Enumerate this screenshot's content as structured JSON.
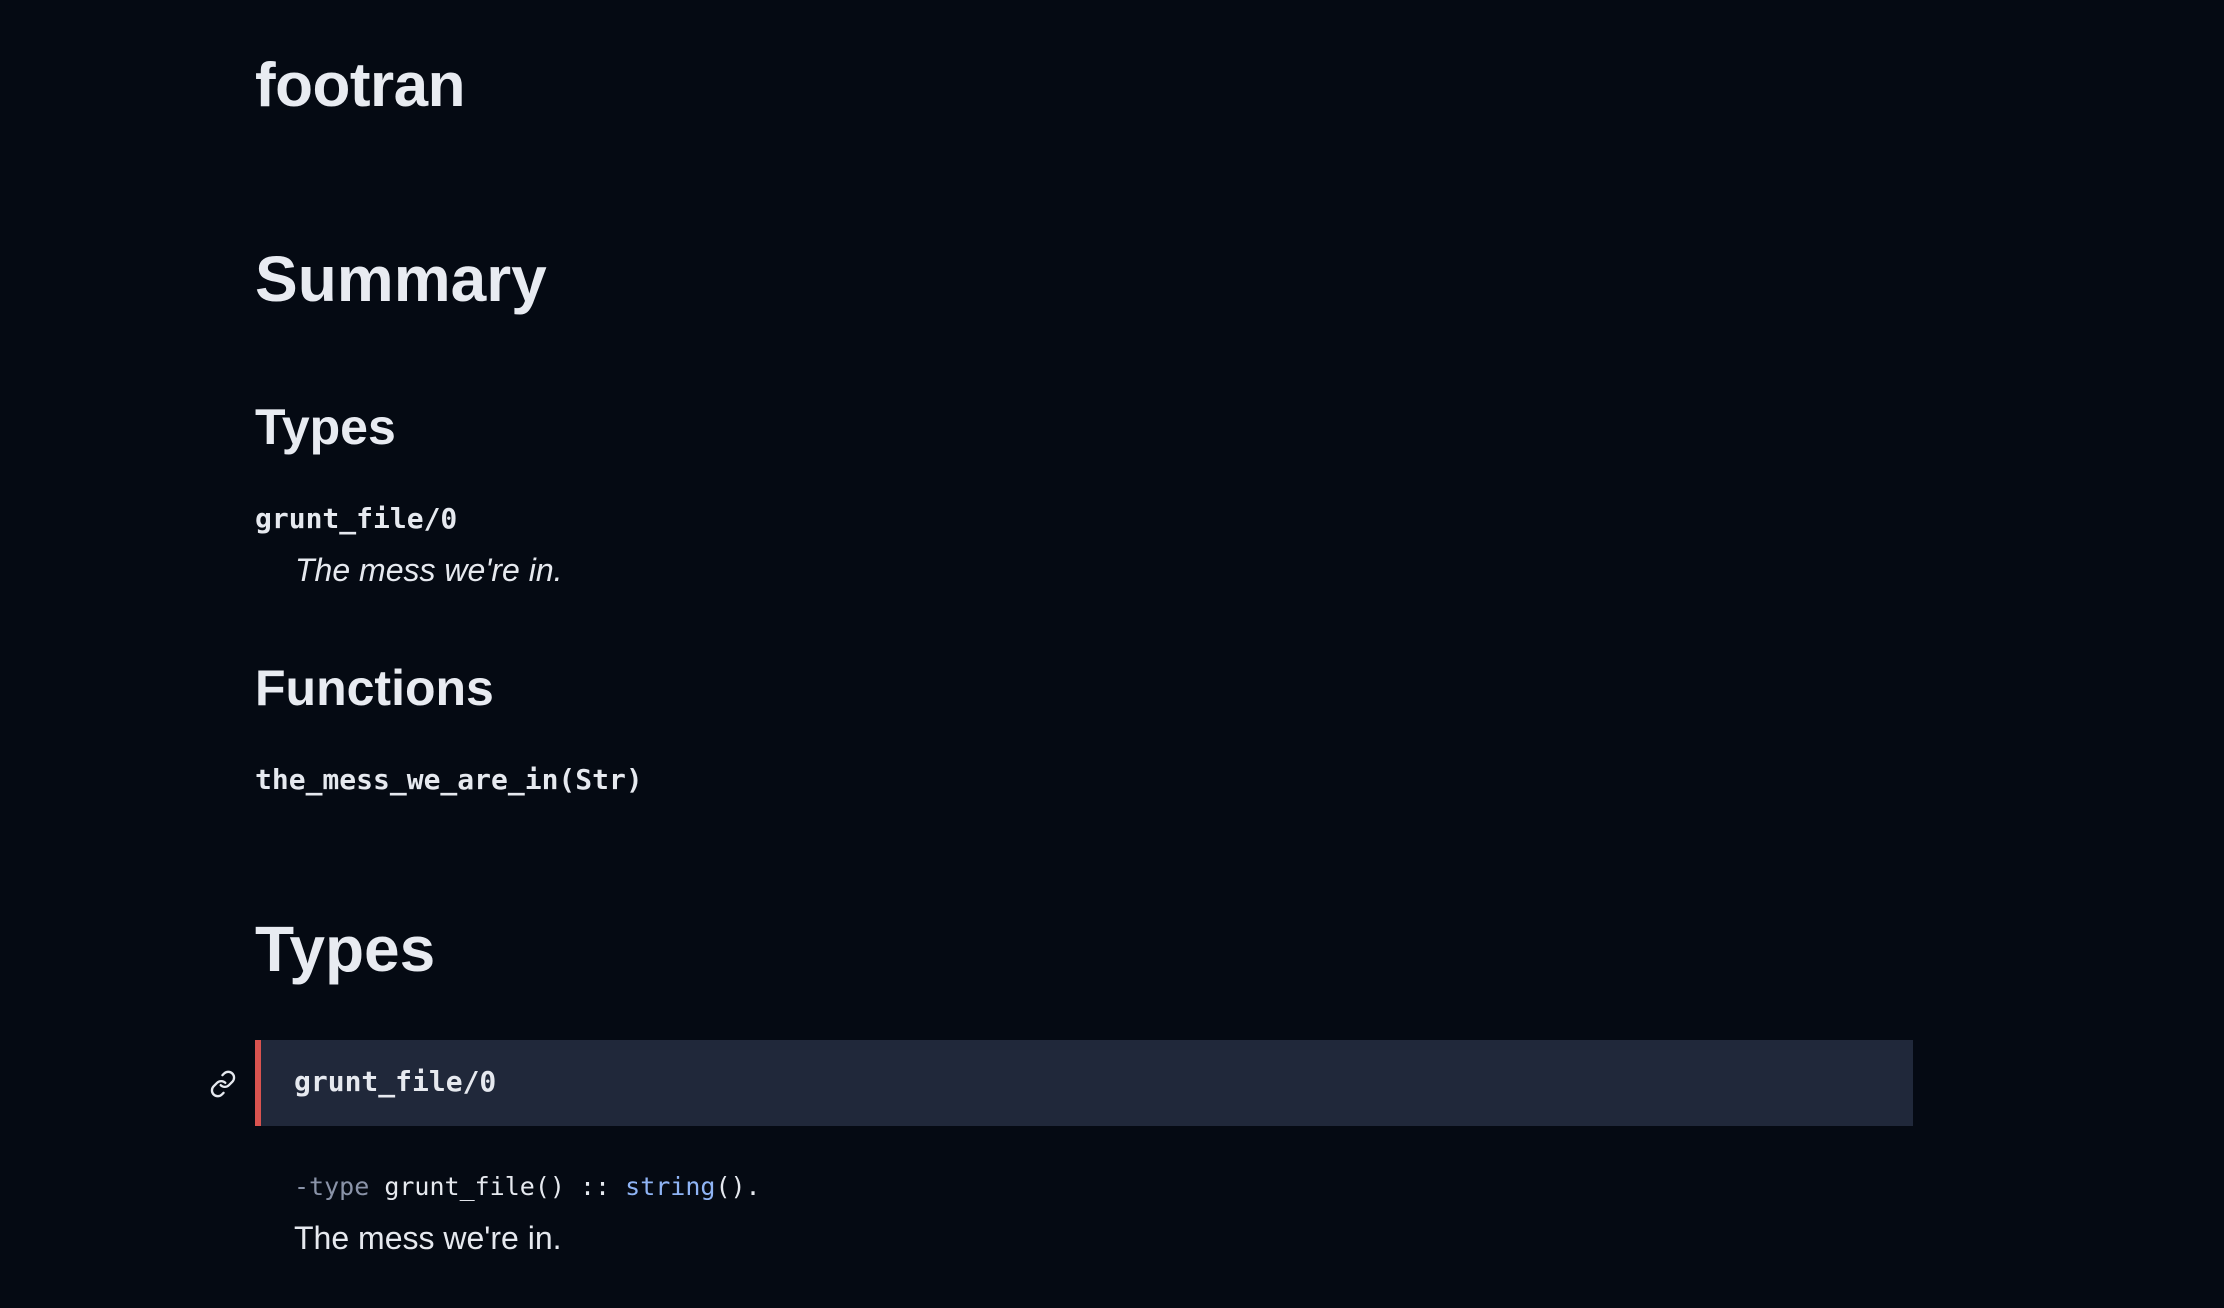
{
  "module": {
    "title": "footran"
  },
  "summary": {
    "heading": "Summary",
    "types_heading": "Types",
    "type_link": "grunt_file/0",
    "type_description": "The mess we're in.",
    "functions_heading": "Functions",
    "function_link": "the_mess_we_are_in(Str)"
  },
  "types_section": {
    "heading": "Types",
    "entry": {
      "title": "grunt_file/0",
      "spec_keyword": "-type",
      "spec_name": " grunt_file() :: ",
      "spec_type": "string",
      "spec_tail": "().",
      "description": "The mess we're in.",
      "link_icon": "link-icon"
    }
  },
  "colors": {
    "background": "#050a13",
    "header_bar": "#20283a",
    "accent_border": "#d9534f",
    "type_link": "#8fb4f5"
  }
}
